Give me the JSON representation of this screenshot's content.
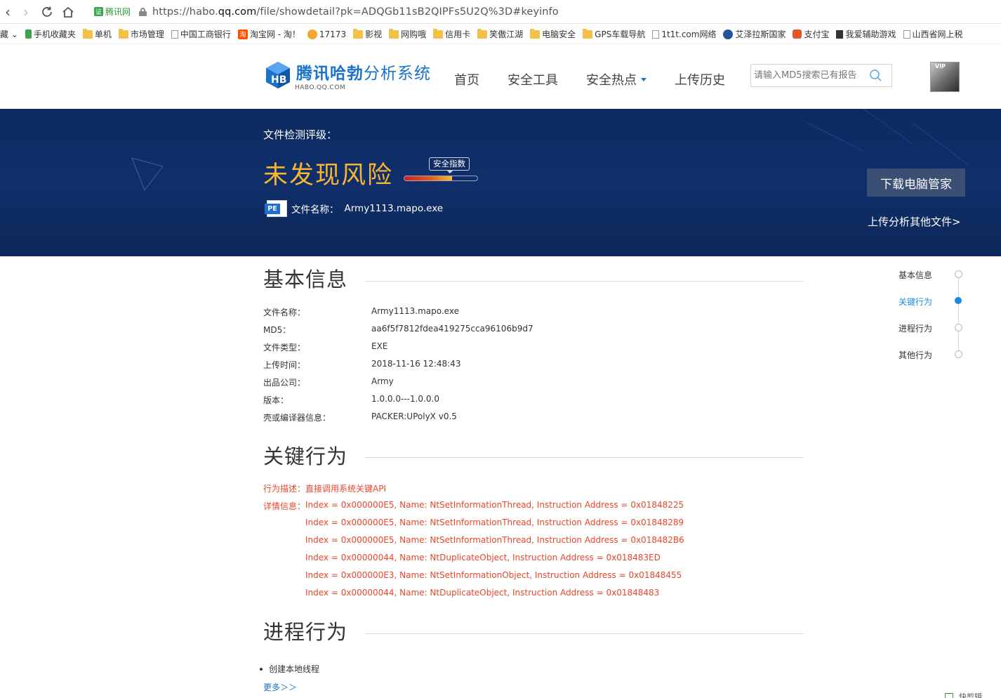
{
  "browser": {
    "site_badge": "腾讯网",
    "url_prefix": "https://habo.",
    "url_domain": "qq.com",
    "url_suffix": "/file/showdetail?pk=ADQGb11sB2QIPFs5U2Q%3D#keyinfo",
    "bookmarks": [
      {
        "label": "藏 ⌄",
        "icon": "none"
      },
      {
        "label": "手机收藏夹",
        "icon": "phone-icon"
      },
      {
        "label": "单机",
        "icon": "folder-icon"
      },
      {
        "label": "市场管理",
        "icon": "folder-icon"
      },
      {
        "label": "中国工商银行",
        "icon": "page-icon"
      },
      {
        "label": "淘宝网 - 淘！",
        "icon": "taobao-icon"
      },
      {
        "label": "17173",
        "icon": "game-icon"
      },
      {
        "label": "影视",
        "icon": "folder-icon"
      },
      {
        "label": "网购哦",
        "icon": "folder-icon"
      },
      {
        "label": "信用卡",
        "icon": "folder-icon"
      },
      {
        "label": "笑傲江湖",
        "icon": "folder-icon"
      },
      {
        "label": "电脑安全",
        "icon": "folder-icon"
      },
      {
        "label": "GPS车载导航",
        "icon": "folder-icon"
      },
      {
        "label": "1t1t.com网络",
        "icon": "page-icon"
      },
      {
        "label": "艾泽拉斯国家",
        "icon": "azeroth-icon"
      },
      {
        "label": "支付宝",
        "icon": "alipay-icon"
      },
      {
        "label": "我爱辅助游戏",
        "icon": "fu-icon"
      },
      {
        "label": "山西省网上税",
        "icon": "page-icon"
      }
    ]
  },
  "header": {
    "logo_title_a": "腾讯哈勃",
    "logo_title_b": "分析系统",
    "logo_sub": "HABO.QQ.COM",
    "nav": [
      "首页",
      "安全工具",
      "安全热点",
      "上传历史"
    ],
    "search_placeholder": "请输入MD5搜索已有报告",
    "avatar_badge": "VIP",
    "colors": {
      "brand": "#1a73c8"
    }
  },
  "hero": {
    "label": "文件检测评级：",
    "verdict": "未发现风险",
    "gauge_tag": "安全指数",
    "gauge_level": 0.65,
    "file_icon_text": "PE",
    "file_label": "文件名称：",
    "file_name": "Army1113.mapo.exe",
    "download_btn": "下载电脑管家",
    "upload_link": "上传分析其他文件>",
    "colors": {
      "verdict": "#f8b630",
      "bg": "#0d2a60"
    }
  },
  "basic": {
    "title": "基本信息",
    "rows": [
      {
        "k": "文件名称：",
        "v": "Army1113.mapo.exe"
      },
      {
        "k": "MD5：",
        "v": "aa6f5f7812fdea419275cca96106b9d7"
      },
      {
        "k": "文件类型：",
        "v": "EXE"
      },
      {
        "k": "上传时间：",
        "v": "2018-11-16 12:48:43"
      },
      {
        "k": "出品公司：",
        "v": "Army"
      },
      {
        "k": "版本：",
        "v": "1.0.0.0---1.0.0.0"
      },
      {
        "k": "壳或编译器信息：",
        "v": "PACKER:UPolyX v0.5"
      }
    ]
  },
  "key": {
    "title": "关键行为",
    "desc": "行为描述：直接调用系统关键API",
    "detail_label": "详情信息：",
    "lines": [
      "Index = 0x000000E5, Name: NtSetInformationThread, Instruction Address = 0x01848225",
      "Index = 0x000000E5, Name: NtSetInformationThread, Instruction Address = 0x01848289",
      "Index = 0x000000E5, Name: NtSetInformationThread, Instruction Address = 0x018482B6",
      "Index = 0x00000044, Name: NtDuplicateObject, Instruction Address = 0x018483ED",
      "Index = 0x000000E3, Name: NtSetInformationObject, Instruction Address = 0x01848455",
      "Index = 0x00000044, Name: NtDuplicateObject, Instruction Address = 0x01848483"
    ],
    "colors": {
      "alert": "#e8462a"
    }
  },
  "process": {
    "title": "进程行为",
    "items": [
      "创建本地线程"
    ],
    "more": "更多＞＞"
  },
  "index_nav": [
    {
      "label": "基本信息",
      "active": false
    },
    {
      "label": "关键行为",
      "active": true
    },
    {
      "label": "进程行为",
      "active": false
    },
    {
      "label": "其他行为",
      "active": false
    }
  ],
  "corner_hint": "快剪辑"
}
